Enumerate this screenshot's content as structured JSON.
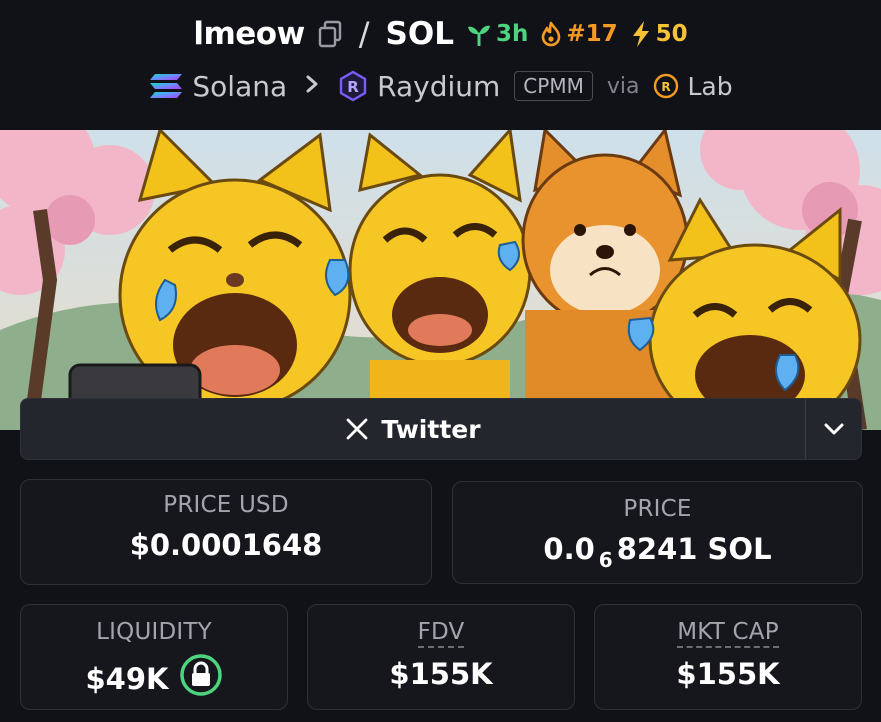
{
  "header": {
    "token_symbol": "lmeow",
    "separator": "/",
    "quote_symbol": "SOL",
    "age": "3h",
    "rank": "#17",
    "boosts": "50",
    "chain": "Solana",
    "dex": "Raydium",
    "pool_type": "CPMM",
    "via": "via",
    "launchpad": "Lab",
    "icons": {
      "copy": "copy-icon",
      "age": "seedling-icon",
      "rank": "flame-icon",
      "boosts": "lightning-icon",
      "chain": "solana-logo-icon",
      "breadcrumb": "chevron-right-icon",
      "dex": "raydium-logo-icon",
      "launchpad": "raydium-lab-logo-icon"
    },
    "colors": {
      "age": "#4cd47f",
      "rank": "#f59a23",
      "boosts": "#f7c234",
      "raydium": "#7b5cff"
    }
  },
  "banner": {
    "description_icon": "token-banner-image"
  },
  "socials": {
    "twitter_label": "Twitter",
    "icons": {
      "twitter": "x-logo-icon",
      "toggle": "chevron-down-icon"
    }
  },
  "stats": {
    "price_usd": {
      "label": "PRICE USD",
      "value": "$0.0001648"
    },
    "price_native": {
      "label": "PRICE",
      "prefix": "0.0",
      "zeros": "6",
      "digits": "8241",
      "unit": "SOL"
    },
    "liquidity": {
      "label": "LIQUIDITY",
      "value": "$49K",
      "icon": "lock-icon",
      "lock_color": "#4cd47f"
    },
    "fdv": {
      "label": "FDV",
      "value": "$155K"
    },
    "mkt_cap": {
      "label": "MKT CAP",
      "value": "$155K"
    }
  }
}
